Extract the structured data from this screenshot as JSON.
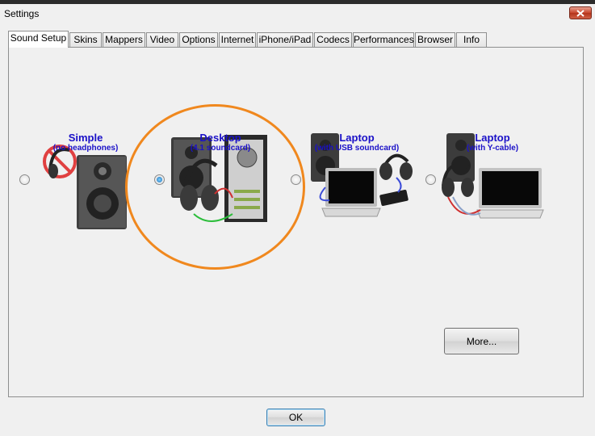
{
  "window": {
    "title": "Settings"
  },
  "tabs": [
    {
      "label": "Sound Setup",
      "active": true
    },
    {
      "label": "Skins"
    },
    {
      "label": "Mappers"
    },
    {
      "label": "Video"
    },
    {
      "label": "Options"
    },
    {
      "label": "Internet"
    },
    {
      "label": "iPhone/iPad"
    },
    {
      "label": "Codecs"
    },
    {
      "label": "Performances"
    },
    {
      "label": "Browser"
    },
    {
      "label": "Info"
    }
  ],
  "setups": [
    {
      "title": "Simple",
      "subtitle": "(no headphones)",
      "selected": false
    },
    {
      "title": "Desktop",
      "subtitle": "(4.1 soundcard)",
      "selected": true
    },
    {
      "title": "Laptop",
      "subtitle": "(with USB soundcard)",
      "selected": false
    },
    {
      "title": "Laptop",
      "subtitle": "(with Y-cable)",
      "selected": false
    }
  ],
  "buttons": {
    "more": "More...",
    "ok": "OK"
  },
  "colors": {
    "label_blue": "#1a10c8",
    "highlight_ring": "#f0881e",
    "close_red": "#c8462c"
  }
}
